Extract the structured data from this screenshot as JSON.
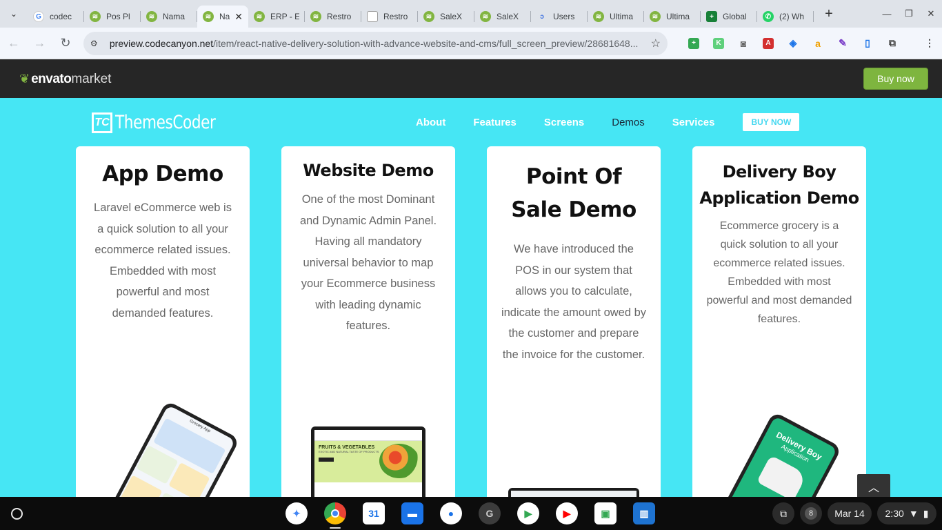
{
  "browser": {
    "tabs": [
      {
        "title": "codec",
        "favicon": "google"
      },
      {
        "title": "Pos Pl",
        "favicon": "envato"
      },
      {
        "title": "Nama",
        "favicon": "envato"
      },
      {
        "title": "Na",
        "favicon": "envato",
        "active": true
      },
      {
        "title": "ERP - E",
        "favicon": "envato"
      },
      {
        "title": "Restro",
        "favicon": "envato"
      },
      {
        "title": "Restro",
        "favicon": "generic"
      },
      {
        "title": "SaleX",
        "favicon": "envato"
      },
      {
        "title": "SaleX",
        "favicon": "envato"
      },
      {
        "title": "Users",
        "favicon": "users"
      },
      {
        "title": "Ultima",
        "favicon": "envato"
      },
      {
        "title": "Ultima",
        "favicon": "envato"
      },
      {
        "title": "Global",
        "favicon": "sheets"
      },
      {
        "title": "(2) Wh",
        "favicon": "whatsapp"
      }
    ],
    "url_host": "preview.codecanyon.net",
    "url_path": "/item/react-native-delivery-solution-with-advance-website-and-cms/full_screen_preview/28681648..."
  },
  "envato": {
    "logo_main": "envato",
    "logo_sub": "market",
    "buy_label": "Buy now"
  },
  "site": {
    "logo_text": "ThemesCoder",
    "logo_mark": "TC",
    "menu": [
      "About",
      "Features",
      "Screens",
      "Demos",
      "Services"
    ],
    "active_menu": "Demos",
    "buy_label": "BUY NOW",
    "cards": [
      {
        "title": "App Demo",
        "text": "Laravel eCommerce web is a quick solution to all your ecommerce related issues. Embedded with most powerful and most demanded features."
      },
      {
        "title": "Website Demo",
        "text": "One of the most Dominant and Dynamic Admin Panel. Having all mandatory universal behavior to map your Ecommerce business with leading dynamic features."
      },
      {
        "title": "Point Of Sale Demo",
        "text": "We have introduced the POS in our system that allows you to calculate, indicate the amount owed by the customer and prepare the invoice for the customer."
      },
      {
        "title": "Delivery Boy Application Demo",
        "text": "Ecommerce grocery is a quick solution to all your ecommerce related issues. Embedded with most powerful and most demanded features."
      }
    ],
    "mockups": {
      "grocery_app_title": "Grocery App",
      "fruits_title": "FRUITS & VEGETABLES",
      "fruits_sub": "EXOTIC AND NATURAL TASTE OF PRODUCTS",
      "delivery_title": "Delivery Boy",
      "delivery_sub": "Application"
    }
  },
  "shelf": {
    "notifications": "8",
    "date": "Mar 14",
    "time": "2:30"
  },
  "colors": {
    "site_bg": "#46e6f4",
    "envato_green": "#82b541",
    "envato_bar": "#262626"
  }
}
